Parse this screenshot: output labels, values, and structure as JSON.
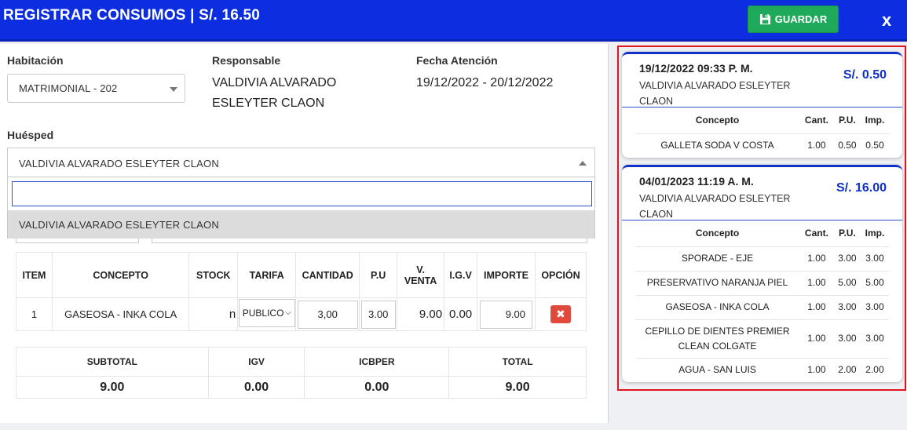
{
  "header": {
    "title": "REGISTRAR CONSUMOS | S/. 16.50",
    "save_label": "GUARDAR",
    "close_label": "x"
  },
  "form": {
    "habitacion_label": "Habitación",
    "habitacion_value": "MATRIMONIAL - 202",
    "responsable_label": "Responsable",
    "responsable_value": "VALDIVIA ALVARADO ESLEYTER CLAON",
    "fecha_label": "Fecha Atención",
    "fecha_value": "19/12/2022 - 20/12/2022",
    "huesped_label": "Huésped",
    "huesped_value": "VALDIVIA ALVARADO ESLEYTER CLAON",
    "huesped_search": "",
    "huesped_option": "VALDIVIA ALVARADO ESLEYTER CLAON"
  },
  "items_table": {
    "headers": [
      "ITEM",
      "CONCEPTO",
      "STOCK",
      "TARIFA",
      "CANTIDAD",
      "P.U",
      "V. VENTA",
      "I.G.V",
      "IMPORTE",
      "OPCIÓN"
    ],
    "rows": [
      {
        "item": "1",
        "concepto": "GASEOSA - INKA COLA",
        "stock": "n",
        "tarifa": "PUBLICO",
        "cantidad": "3,00",
        "pu": "3.00",
        "v_venta": "9.00",
        "igv": "0.00",
        "importe": "9.00",
        "delete_label": "✖"
      }
    ]
  },
  "totals": {
    "subtotal_label": "SUBTOTAL",
    "igv_label": "IGV",
    "icbper_label": "ICBPER",
    "total_label": "TOTAL",
    "subtotal": "9.00",
    "igv": "0.00",
    "icbper": "0.00",
    "total": "9.00"
  },
  "history": {
    "headers": {
      "concepto": "Concepto",
      "cant": "Cant.",
      "pu": "P.U.",
      "imp": "Imp."
    },
    "cards": [
      {
        "date": "19/12/2022 09:33 P. M.",
        "name": "VALDIVIA ALVARADO ESLEYTER CLAON",
        "amount": "S/. 0.50",
        "items": [
          {
            "concepto": "GALLETA SODA V COSTA",
            "cant": "1.00",
            "pu": "0.50",
            "imp": "0.50"
          }
        ]
      },
      {
        "date": "04/01/2023 11:19 A. M.",
        "name": "VALDIVIA ALVARADO ESLEYTER CLAON",
        "amount": "S/. 16.00",
        "items": [
          {
            "concepto": "SPORADE - EJE",
            "cant": "1.00",
            "pu": "3.00",
            "imp": "3.00"
          },
          {
            "concepto": "PRESERVATIVO NARANJA PIEL",
            "cant": "1.00",
            "pu": "5.00",
            "imp": "5.00"
          },
          {
            "concepto": "GASEOSA - INKA COLA",
            "cant": "1.00",
            "pu": "3.00",
            "imp": "3.00"
          },
          {
            "concepto": "CEPILLO DE DIENTES PREMIER CLEAN COLGATE",
            "cant": "1.00",
            "pu": "3.00",
            "imp": "3.00"
          },
          {
            "concepto": "AGUA - SAN LUIS",
            "cant": "1.00",
            "pu": "2.00",
            "imp": "2.00"
          }
        ]
      }
    ]
  },
  "colors": {
    "header_blue": "#0d2ee0",
    "save_green": "#1eaa5a",
    "accent_blue": "#1030c8",
    "delete_red": "#e04a3c",
    "highlight_red": "#e0141c"
  }
}
